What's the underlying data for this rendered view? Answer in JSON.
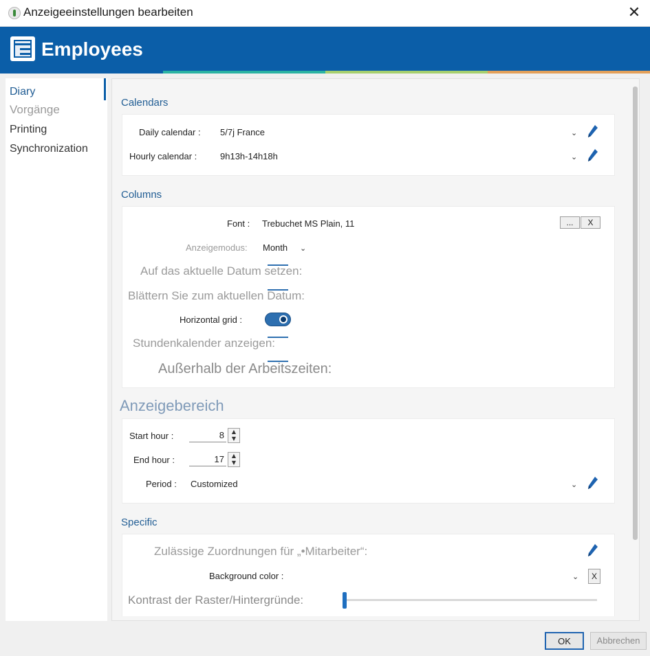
{
  "window": {
    "title": "Anzeigeeinstellungen bearbeiten",
    "close_glyph": "✕"
  },
  "banner": {
    "title": "Employees",
    "icon": "table-icon",
    "color": "#0b5ea8",
    "stripes": [
      "#0b5ea8",
      "#2bb3a3",
      "#a6cf6e",
      "#e3a05a"
    ]
  },
  "sidebar": {
    "items": [
      {
        "label": "Diary",
        "selected": true
      },
      {
        "label": "Vorgänge",
        "selected": false
      },
      {
        "label": "Printing",
        "selected": false
      },
      {
        "label": "Synchronization",
        "selected": false
      }
    ]
  },
  "calendars": {
    "title": "Calendars",
    "daily_label": "Daily calendar :",
    "daily_value": "5/7j France",
    "hourly_label": "Hourly calendar :",
    "hourly_value": "9h13h-14h18h"
  },
  "columns": {
    "title": "Columns",
    "font_label": "Font :",
    "font_value": "Trebuchet MS Plain, 11",
    "font_browse": "...",
    "font_clear": "X",
    "mode_label": "Anzeigemodus:",
    "mode_value": "Month",
    "set_date_label": "Auf das aktuelle Datum setzen:",
    "scroll_date_label": "Blättern Sie zum aktuellen Datum:",
    "hgrid_label": "Horizontal grid :",
    "hgrid_on": true,
    "hourly_show_label": "Stundenkalender anzeigen:",
    "outside_hours_label": "Außerhalb der Arbeitszeiten:"
  },
  "range": {
    "title": "Anzeigebereich",
    "start_label": "Start hour :",
    "start_value": "8",
    "end_label": "End hour :",
    "end_value": "17",
    "period_label": "Period :",
    "period_value": "Customized"
  },
  "specific": {
    "title": "Specific",
    "assign_label": "Zulässige Zuordnungen für „•Mitarbeiter“:",
    "bg_label": "Background color :",
    "bg_clear": "X",
    "contrast_label": "Kontrast der Raster/Hintergründe:",
    "contrast_level": 0
  },
  "buttons": {
    "ok": "OK",
    "cancel": "Abbrechen"
  }
}
